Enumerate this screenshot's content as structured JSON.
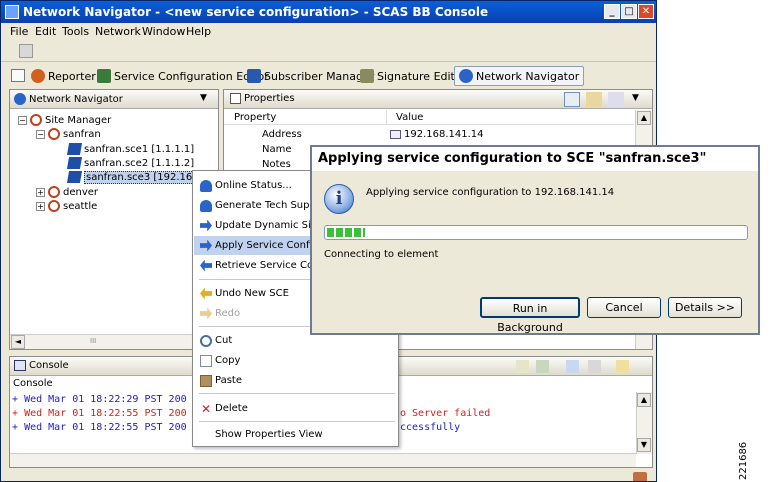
{
  "window": {
    "title": "Network Navigator - <new service configuration> - SCAS BB Console",
    "min_glyph": "_",
    "max_glyph": "□",
    "close_glyph": "✕"
  },
  "menu": [
    "File",
    "Edit",
    "Tools",
    "Network",
    "Window",
    "Help"
  ],
  "perspectives": [
    {
      "label": "Reporter",
      "color": "#d06020"
    },
    {
      "label": "Service Configuration Editor",
      "color": "#3a7a3a"
    },
    {
      "label": "Subscriber Manager",
      "color": "#2a58b0"
    },
    {
      "label": "Signature Editor",
      "color": "#8a8a60"
    },
    {
      "label": "Network Navigator",
      "color": "#2a64c8"
    }
  ],
  "navigator": {
    "tab_label": "Network Navigator",
    "menu_glyph": "▼",
    "tree": [
      {
        "label": "Site Manager",
        "toggle": "−"
      },
      {
        "label": "sanfran",
        "toggle": "−"
      },
      {
        "label": "sanfran.sce1 [1.1.1.1]"
      },
      {
        "label": "sanfran.sce2 [1.1.1.2]"
      },
      {
        "label": "sanfran.sce3 [192.168.1"
      },
      {
        "label": "denver",
        "toggle": "+"
      },
      {
        "label": "seattle",
        "toggle": "+"
      }
    ],
    "hscroll_left": "◄",
    "hscroll_grip": "III"
  },
  "properties": {
    "tab_label": "Properties",
    "col_property": "Property",
    "col_value": "Value",
    "rows": [
      {
        "name": "Address",
        "value": "192.168.141.14"
      },
      {
        "name": "Name",
        "value": ""
      },
      {
        "name": "Notes",
        "value": ""
      }
    ],
    "scroll_up": "▲",
    "menu_glyph": "▼"
  },
  "context_menu": [
    {
      "label": "Online Status...",
      "color": "#2a64c8"
    },
    {
      "label": "Generate Tech Suppor",
      "color": "#2a64c8"
    },
    {
      "label": "Update Dynamic Signa",
      "color": "#2a64c8"
    },
    {
      "label": "Apply Service Configu",
      "color": "#2a64c8"
    },
    {
      "label": "Retrieve Service Confi",
      "color": "#2a64c8"
    },
    {
      "label": "Undo New SCE",
      "color": "#e0b020"
    },
    {
      "label": "Redo",
      "color": "#e8d090"
    },
    {
      "label": "Cut",
      "color": "#4a6aa0"
    },
    {
      "label": "Copy",
      "color": "#7a8ab0"
    },
    {
      "label": "Paste",
      "color": "#b09060"
    },
    {
      "label": "Delete",
      "color": "#d02020"
    },
    {
      "label": "Show Properties View"
    }
  ],
  "dialog": {
    "title": "Applying service configuration to SCE \"sanfran.sce3\"",
    "info_glyph": "i",
    "message": "Applying service configuration to 192.168.141.14",
    "progress": 0.09,
    "status": "Connecting to element",
    "buttons": {
      "background": "Run in Background",
      "cancel": "Cancel",
      "details": "Details >>"
    }
  },
  "console": {
    "tab_label": "Console",
    "subtitle": "Console",
    "lines": [
      {
        "prefix": "+",
        "text": "Wed Mar 01 18:22:29 PST 200",
        "tail": "",
        "color": "#2020c0"
      },
      {
        "prefix": "+",
        "text": "Wed Mar 01 18:22:55 PST 200",
        "tail": "o Server failed",
        "color": "#d02020"
      },
      {
        "prefix": "+",
        "text": "Wed Mar 01 18:22:55 PST 200",
        "tail": "ccessfully",
        "color": "#2020c0"
      }
    ],
    "scroll_up": "▲",
    "scroll_down": "▼"
  },
  "side_label": "221686"
}
